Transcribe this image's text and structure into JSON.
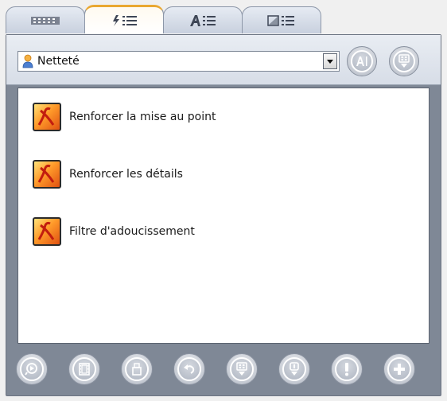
{
  "tabs": [
    {
      "icon": "filmstrip-icon",
      "active": false
    },
    {
      "icon": "effects-list-icon",
      "active": true
    },
    {
      "icon": "text-list-icon",
      "active": false
    },
    {
      "icon": "transition-list-icon",
      "active": false
    }
  ],
  "category": {
    "selected": "Netteté",
    "icon": "person-icon"
  },
  "header_buttons": [
    {
      "name": "text-style-button",
      "icon": "text-cursor-icon"
    },
    {
      "name": "view-options-button",
      "icon": "grid-down-icon"
    }
  ],
  "effects": [
    {
      "label": "Renforcer la mise au point"
    },
    {
      "label": "Renforcer les détails"
    },
    {
      "label": "Filtre d'adoucissement"
    }
  ],
  "toolbar": [
    {
      "name": "preview-button",
      "icon": "magnify-play-icon"
    },
    {
      "name": "film-button",
      "icon": "film-icon"
    },
    {
      "name": "clip-button",
      "icon": "clip-icon"
    },
    {
      "name": "undo-button",
      "icon": "undo-arrow-icon"
    },
    {
      "name": "grid-down-button",
      "icon": "grid-down-icon"
    },
    {
      "name": "import-button",
      "icon": "download-icon"
    },
    {
      "name": "info-button",
      "icon": "exclamation-icon"
    },
    {
      "name": "add-button",
      "icon": "plus-icon"
    }
  ],
  "colors": {
    "accent_tab": "#e9a731",
    "panel": "#7f8896",
    "effect_icon": "#ff9b2a"
  }
}
